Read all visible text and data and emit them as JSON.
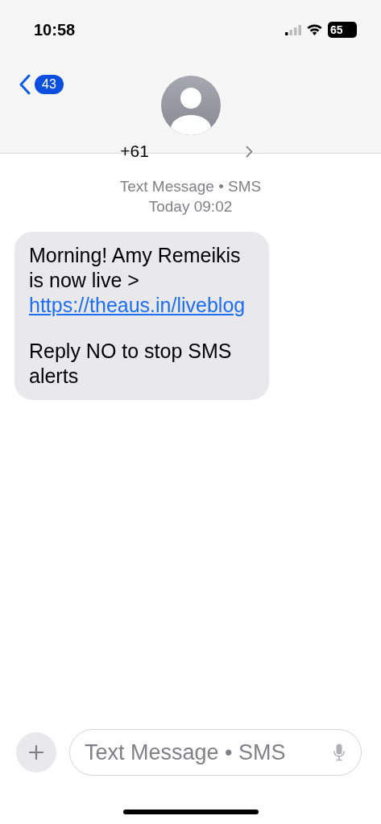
{
  "status_bar": {
    "time": "10:58",
    "battery": "65"
  },
  "header": {
    "back_badge": "43",
    "contact": "+61"
  },
  "thread": {
    "service": "Text Message • SMS",
    "timestamp": "Today 09:02",
    "messages": [
      {
        "text_before": "Morning! Amy Remeikis is now live >",
        "link": "https://theaus.in/liveblog",
        "text_after": "Reply NO to stop SMS alerts"
      }
    ]
  },
  "composer": {
    "placeholder": "Text Message • SMS"
  }
}
